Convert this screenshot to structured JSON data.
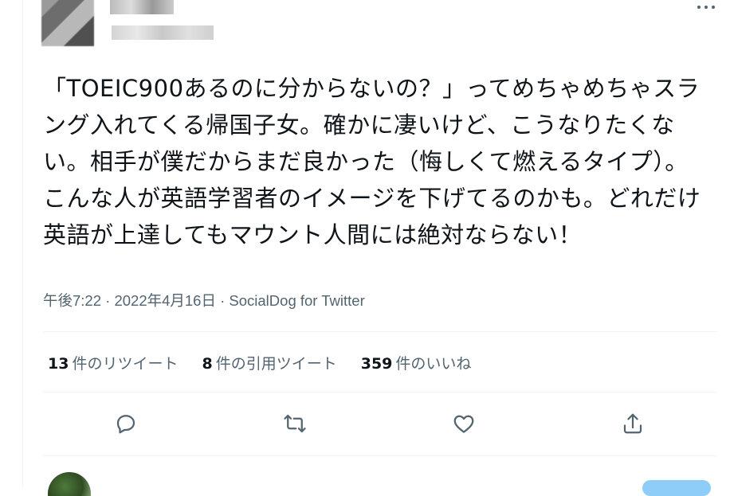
{
  "tweet": {
    "text": "「TOEIC900あるのに分からないの？」ってめちゃめちゃスラング入れてくる帰国子女。確かに凄いけど、こうなりたくない。相手が僕だからまだ良かった（悔しくて燃えるタイプ）。こんな人が英語学習者のイメージを下げてるのかも。どれだけ英語が上達してもマウント人間には絶対ならない！",
    "meta": "午後7:22 · 2022年4月16日 · SocialDog for Twitter"
  },
  "stats": {
    "retweets_count": "13",
    "retweets_label": "件のリツイート",
    "quotes_count": "8",
    "quotes_label": "件の引用ツイート",
    "likes_count": "359",
    "likes_label": "件のいいね"
  },
  "icons": {
    "more": "more-icon",
    "reply": "reply-icon",
    "retweet": "retweet-icon",
    "like": "heart-icon",
    "share": "share-icon"
  },
  "colors": {
    "text": "#0f1419",
    "secondary": "#536471",
    "divider": "#eff3f4",
    "reply_button": "#8ecdf7"
  }
}
